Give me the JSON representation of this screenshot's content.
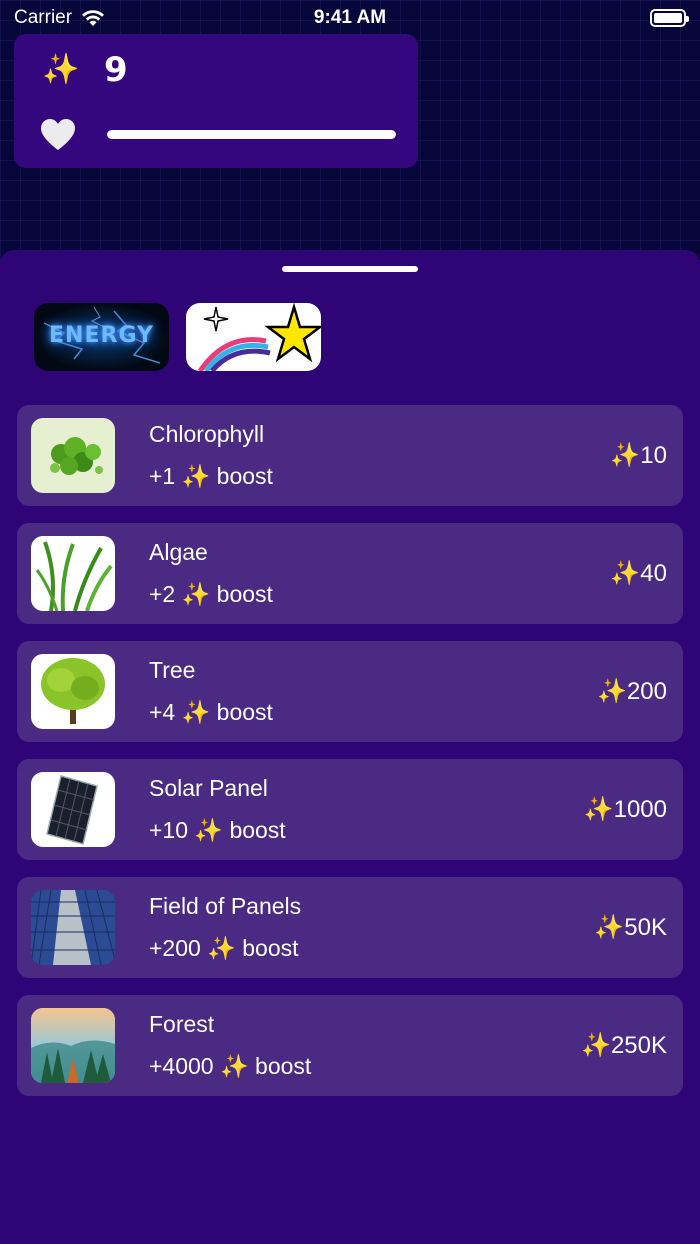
{
  "status_bar": {
    "carrier": "Carrier",
    "time": "9:41 AM"
  },
  "stats": {
    "energy_icon": "✨",
    "energy_value": "9",
    "heart_icon": "heart-icon",
    "health_fraction": 1.0
  },
  "sheet": {
    "tabs": [
      {
        "label": "ENERGY",
        "icon": "energy-tab-image"
      },
      {
        "label": "",
        "icon": "shooting-star-image"
      }
    ],
    "items": [
      {
        "name": "Chlorophyll",
        "boost_prefix": "+1",
        "sparkle": "✨",
        "boost_suffix": "boost",
        "cost": "✨10"
      },
      {
        "name": "Algae",
        "boost_prefix": "+2",
        "sparkle": "✨",
        "boost_suffix": "boost",
        "cost": "✨40"
      },
      {
        "name": "Tree",
        "boost_prefix": "+4",
        "sparkle": "✨",
        "boost_suffix": "boost",
        "cost": "✨200"
      },
      {
        "name": "Solar Panel",
        "boost_prefix": "+10",
        "sparkle": "✨",
        "boost_suffix": "boost",
        "cost": "✨1000"
      },
      {
        "name": "Field of Panels",
        "boost_prefix": "+200",
        "sparkle": "✨",
        "boost_suffix": "boost",
        "cost": "✨50K"
      },
      {
        "name": "Forest",
        "boost_prefix": "+4000",
        "sparkle": "✨",
        "boost_suffix": "boost",
        "cost": "✨250K"
      }
    ]
  }
}
